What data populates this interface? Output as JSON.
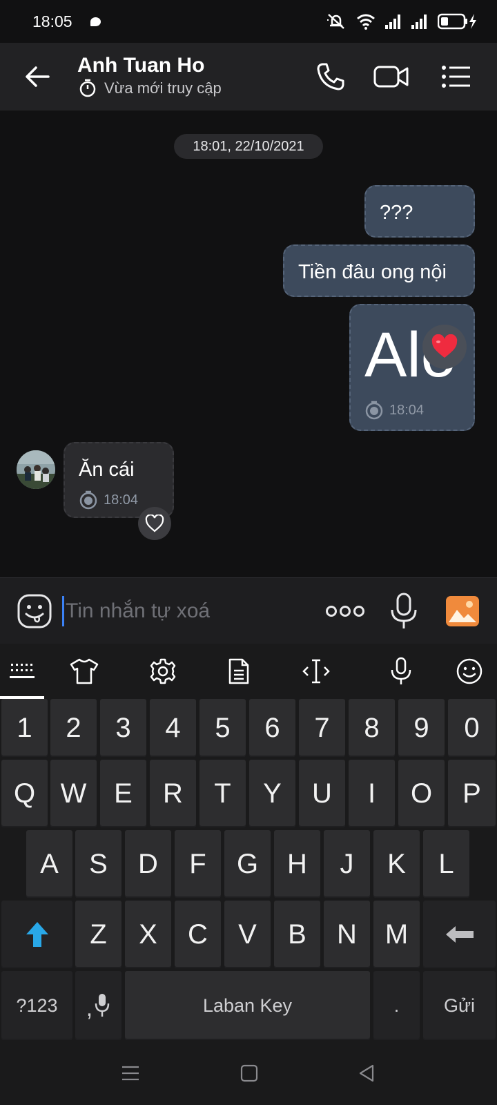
{
  "status_bar": {
    "time": "18:05"
  },
  "header": {
    "contact_name": "Anh Tuan Ho",
    "presence": "Vừa mới truy cập"
  },
  "chat": {
    "date_separator": "18:01, 22/10/2021",
    "messages": [
      {
        "direction": "outgoing",
        "text": "???"
      },
      {
        "direction": "outgoing",
        "text": "Tiền đâu ong nội"
      },
      {
        "direction": "outgoing",
        "text": "Alo",
        "time": "18:04",
        "reaction": "heart-emoji"
      },
      {
        "direction": "incoming",
        "text": "Ăn cái",
        "time": "18:04",
        "reaction": "heart-outline-icon"
      }
    ]
  },
  "composer": {
    "placeholder": "Tin nhắn tự xoá"
  },
  "keyboard": {
    "number_row": [
      "1",
      "2",
      "3",
      "4",
      "5",
      "6",
      "7",
      "8",
      "9",
      "0"
    ],
    "row1": [
      "Q",
      "W",
      "E",
      "R",
      "T",
      "Y",
      "U",
      "I",
      "O",
      "P"
    ],
    "row2": [
      "A",
      "S",
      "D",
      "F",
      "G",
      "H",
      "J",
      "K",
      "L"
    ],
    "row3": [
      "Z",
      "X",
      "C",
      "V",
      "B",
      "N",
      "M"
    ],
    "symbols_key": "?123",
    "comma_key": ",",
    "space_key": "Laban Key",
    "period_key": ".",
    "send_key": "Gửi"
  },
  "colors": {
    "outgoing_bubble": "#3d4a5c",
    "incoming_bubble": "#2b2b2e",
    "caret": "#3b82f6",
    "shift_arrow": "#29a8e8",
    "gallery_icon": "#f08a3c"
  }
}
